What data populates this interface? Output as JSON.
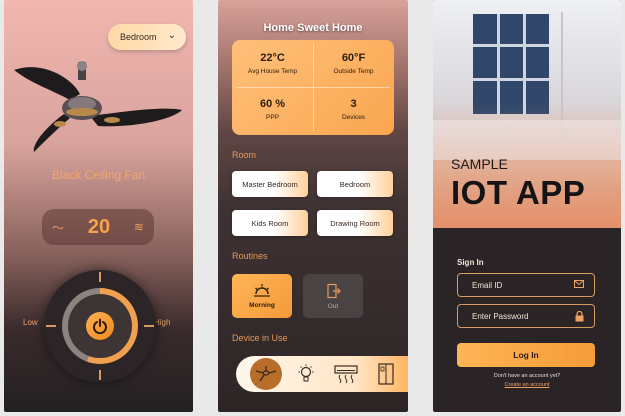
{
  "fan_screen": {
    "room_selector": {
      "value": "Bedroom",
      "icon": "chevron-down-icon"
    },
    "device_name": "Black Ceiling Fan",
    "temperature": "20",
    "speed_low_label": "Low",
    "speed_high_label": "High",
    "power_state": "on",
    "icons": [
      "fan-image",
      "dry-mode-icon",
      "wave-mode-icon",
      "power-icon"
    ]
  },
  "home_screen": {
    "title": "Home Sweet Home",
    "stats": [
      {
        "value": "22°C",
        "label": "Avg House Temp"
      },
      {
        "value": "60°F",
        "label": "Outside Temp"
      },
      {
        "value": "60 %",
        "label": "PPP"
      },
      {
        "value": "3",
        "label": "Devices"
      }
    ],
    "room_heading": "Room",
    "rooms": [
      "Master Bedroom",
      "Bedroom",
      "Kids Room",
      "Drawing Room"
    ],
    "routines_heading": "Routines",
    "routines": [
      {
        "label": "Morning",
        "icon": "sunrise-icon",
        "active": true
      },
      {
        "label": "Out",
        "icon": "exit-door-icon",
        "active": false
      }
    ],
    "devices_heading": "Device in Use",
    "devices": [
      "fan-icon",
      "bulb-icon",
      "air-conditioner-icon",
      "fridge-icon"
    ]
  },
  "login_screen": {
    "hero_line1": "SAMPLE",
    "hero_line2": "IOT APP",
    "signin_label": "Sign In",
    "email": {
      "placeholder": "Email ID",
      "icon": "mail-icon"
    },
    "password": {
      "placeholder": "Enter Password",
      "icon": "lock-icon"
    },
    "login_button": "Log In",
    "no_account_text": "Don't have an account yet?",
    "create_account_link": "Create an account"
  },
  "colors": {
    "accent": "#f8a24c",
    "accent_light": "#ffc07a",
    "dark_bg": "#2c2526",
    "pink_top": "#f2b6b0"
  }
}
